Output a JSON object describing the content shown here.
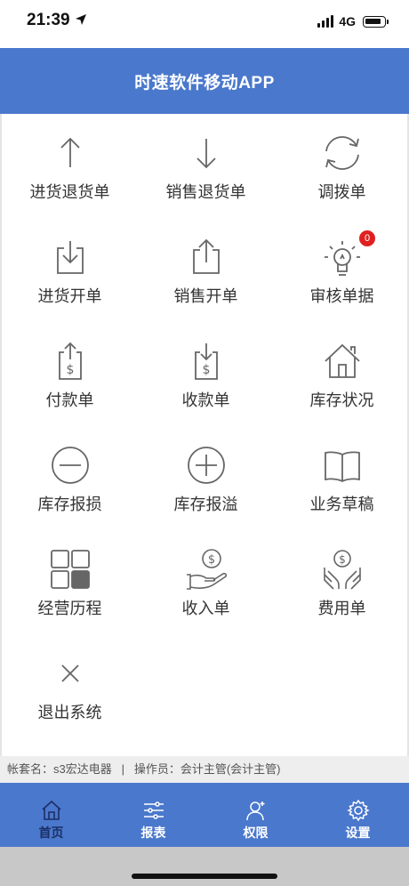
{
  "status": {
    "time": "21:39",
    "network": "4G"
  },
  "header": {
    "title": "时速软件移动APP"
  },
  "menu": [
    {
      "label": "进货退货单",
      "icon": "arrow-up-icon"
    },
    {
      "label": "销售退货单",
      "icon": "arrow-down-icon"
    },
    {
      "label": "调拨单",
      "icon": "refresh-icon"
    },
    {
      "label": "进货开单",
      "icon": "download-box-icon"
    },
    {
      "label": "销售开单",
      "icon": "share-box-icon"
    },
    {
      "label": "审核单据",
      "icon": "lightbulb-icon",
      "badge": "0"
    },
    {
      "label": "付款单",
      "icon": "pay-out-icon"
    },
    {
      "label": "收款单",
      "icon": "pay-in-icon"
    },
    {
      "label": "库存状况",
      "icon": "house-icon"
    },
    {
      "label": "库存报损",
      "icon": "minus-circle-icon"
    },
    {
      "label": "库存报溢",
      "icon": "plus-circle-icon"
    },
    {
      "label": "业务草稿",
      "icon": "open-book-icon"
    },
    {
      "label": "经营历程",
      "icon": "grid-icon"
    },
    {
      "label": "收入单",
      "icon": "hand-coin-icon"
    },
    {
      "label": "费用单",
      "icon": "hands-coin-icon"
    },
    {
      "label": "退出系统",
      "icon": "close-icon"
    }
  ],
  "account": {
    "account_label": "帐套名：",
    "account_value": "s3宏达电器",
    "separator": "|",
    "operator_label": "操作员：",
    "operator_value": "会计主管(会计主管)"
  },
  "tabs": [
    {
      "label": "首页",
      "icon": "home-icon",
      "active": true
    },
    {
      "label": "报表",
      "icon": "sliders-icon",
      "active": false
    },
    {
      "label": "权限",
      "icon": "user-add-icon",
      "active": false
    },
    {
      "label": "设置",
      "icon": "gear-icon",
      "active": false
    }
  ],
  "colors": {
    "primary": "#4a78cc",
    "tab_active": "#1b2f66",
    "badge": "#e02020"
  }
}
